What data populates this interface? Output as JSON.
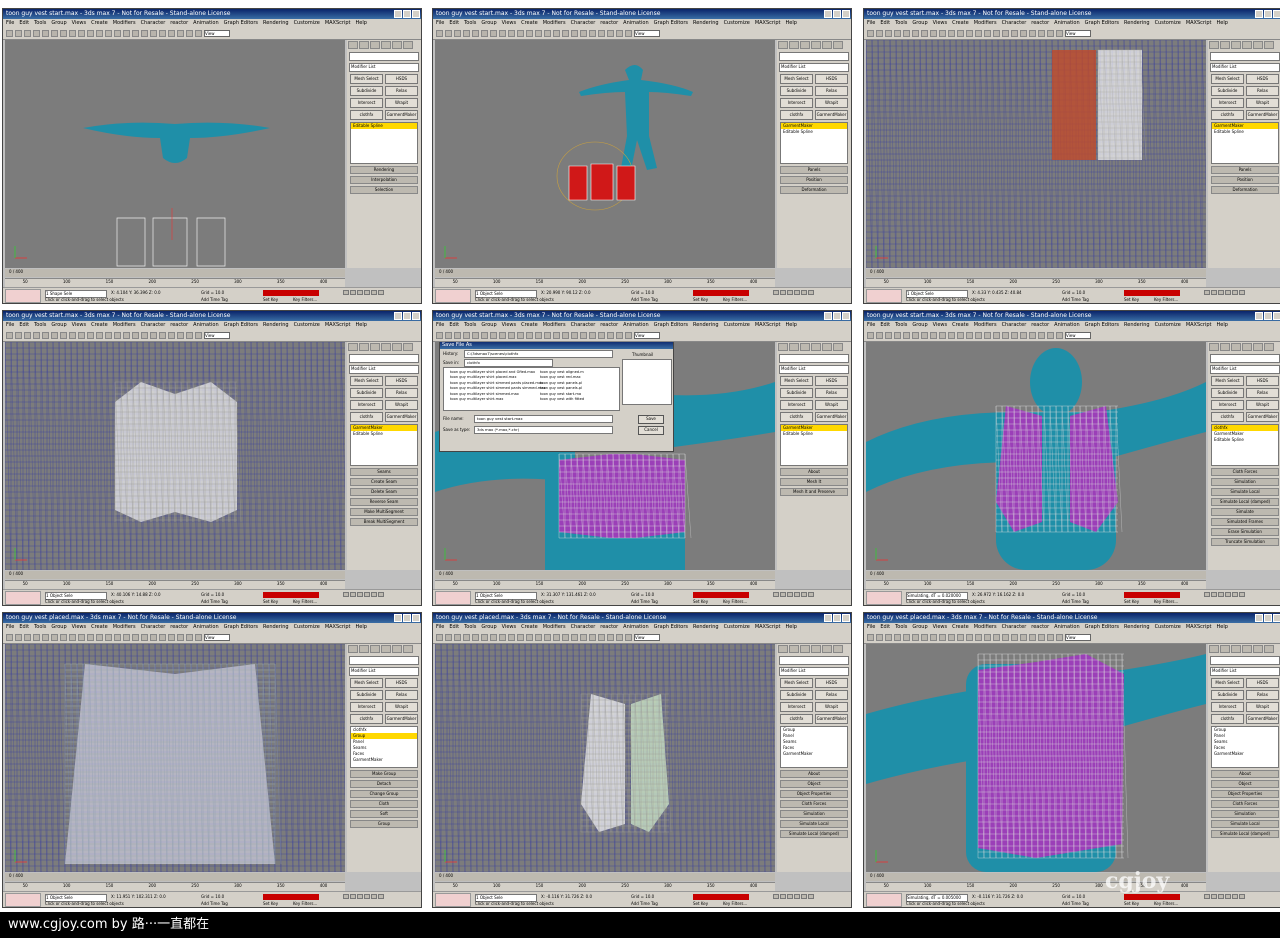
{
  "footer": {
    "text": "www.cgjoy.com by 路···一直都在"
  },
  "watermark": {
    "text": "cgjoy"
  },
  "app": {
    "menu": [
      "File",
      "Edit",
      "Tools",
      "Group",
      "Views",
      "Create",
      "Modifiers",
      "Character",
      "reactor",
      "Animation",
      "Graph Editors",
      "Rendering",
      "Customize",
      "MAXScript",
      "Help"
    ],
    "viewport_label": "View",
    "modifier_list": "Modifier List",
    "buttons": [
      [
        "Mesh Select",
        "HSDS"
      ],
      [
        "Subdivide",
        "Relax"
      ],
      [
        "Intersect",
        "Wrapit"
      ],
      [
        "clothfx",
        "GarmentMaker"
      ]
    ],
    "timeline_label": "0 / 400",
    "ticks": [
      "50",
      "100",
      "150",
      "200",
      "250",
      "300",
      "350",
      "400"
    ],
    "grid": "Grid = 10.0",
    "add_time_tag": "Add Time Tag",
    "auto_key": "Auto Key",
    "selected": "Selected",
    "set_key": "Set Key",
    "key_filters": "Key Filters...",
    "status_hint": "Click or click-and-drag to select objects"
  },
  "panels": [
    {
      "title": "toon guy vest start.max - 3ds max 7 - Not for Resale - Stand-alone License",
      "status": "1 Shape Sele",
      "coords": "X: 4.104   Y: 36.396   Z: 0.0",
      "stack": [
        "Editable Spline"
      ],
      "stack_hl": 0,
      "rollouts": [
        "Rendering",
        "Interpolation",
        "Selection"
      ]
    },
    {
      "title": "toon guy vest start.max - 3ds max 7 - Not for Resale - Stand-alone License",
      "status": "1 Object Sele",
      "coords": "X: 20.990   Y: 90.12   Z: 0.0",
      "stack": [
        "GarmentMaker",
        "Editable Spline"
      ],
      "stack_hl": 0,
      "rollouts": [
        "Panels",
        "Position",
        "Deformation"
      ]
    },
    {
      "title": "toon guy vest start.max - 3ds max 7 - Not for Resale - Stand-alone License",
      "status": "1 Object Sele",
      "coords": "X: 4.33   Y: 0.435   Z: 40.84",
      "stack": [
        "GarmentMaker",
        "Editable Spline"
      ],
      "stack_hl": 0,
      "rollouts": [
        "Panels",
        "Position",
        "Deformation"
      ]
    },
    {
      "title": "toon guy vest start.max - 3ds max 7 - Not for Resale - Stand-alone License",
      "status": "1 Object Sele",
      "coords": "X: 40.106   Y: 14.88   Z: 0.0",
      "stack": [
        "GarmentMaker",
        "Editable Spline"
      ],
      "stack_hl": 0,
      "rollouts": [
        "Seams",
        "Create Seam",
        "Delete Seam",
        "Reverse Seam",
        "Make MultiSegment",
        "Break MultiSegment"
      ]
    },
    {
      "title": "toon guy vest start.max - 3ds max 7 - Not for Resale - Stand-alone License",
      "status": "1 Object Sele",
      "coords": "X: 31.307   Y: 131.461   Z: 0.0",
      "stack": [
        "GarmentMaker",
        "Editable Spline"
      ],
      "stack_hl": 0,
      "rollouts": [
        "About",
        "Mesh It",
        "Mesh It and Preserve"
      ],
      "dialog": {
        "title": "Save File As",
        "history_label": "History:",
        "history": "C:\\3dsmax7\\scenes\\clothfx",
        "savein_label": "Save in:",
        "savein": "clothfx",
        "thumb_label": "Thumbnail",
        "files": [
          "toon guy multilayer shirt placed and Gfied.max",
          "toon guy multilayer shirt placed.max",
          "toon guy multilayer shirt simmed pants placed.max",
          "toon guy multilayer shirt simmed pants simmed.max",
          "toon guy multilayer shirt simmed.max",
          "toon guy multilayer shirt.max"
        ],
        "files2": [
          "toon guy vest aligned.m",
          "toon guy vest red.max",
          "toon guy vest panels.pl",
          "toon guy vest panels.pl",
          "toon guy vest start.ma",
          "toon guy vest with fitted"
        ],
        "filename_label": "File name:",
        "filename": "toon guy vest start.max",
        "saveas_label": "Save as type:",
        "saveas": "3ds max (*.max,*.chr)",
        "save": "Save",
        "cancel": "Cancel"
      }
    },
    {
      "title": "toon guy vest start.max - 3ds max 7 - Not for Resale - Stand-alone License",
      "status": "Simulating, dT = 0.020000",
      "coords": "X: 26.972   Y: 16.162   Z: 0.0",
      "stack": [
        "clothfx",
        "GarmentMaker",
        "Editable Spline"
      ],
      "stack_hl": 0,
      "rollouts": [
        "Cloth Forces",
        "Simulation",
        "Simulate Local",
        "Simulate Local (damped)",
        "Simulate",
        "Simulated Frames",
        "Erase Simulation",
        "Truncate Simulation"
      ]
    },
    {
      "title": "toon guy vest placed.max - 3ds max 7 - Not for Resale - Stand-alone License",
      "status": "1 Object Sele",
      "coords": "X: 11.951   Y: 102.311   Z: 0.0",
      "stack": [
        "clothfx",
        "Group",
        "Panel",
        "Seams",
        "Faces",
        "GarmentMaker"
      ],
      "stack_hl": 1,
      "rollouts": [
        "Make Group",
        "Detach",
        "Change Group",
        "Cloth",
        "Soft",
        "Group"
      ]
    },
    {
      "title": "toon guy vest placed.max - 3ds max 7 - Not for Resale - Stand-alone License",
      "status": "1 Object Sele",
      "coords": "X: -0.116   Y: 31.726   Z: 0.0",
      "stack": [
        "Group",
        "Panel",
        "Seams",
        "Faces",
        "GarmentMaker"
      ],
      "stack_hl": -1,
      "rollouts": [
        "About",
        "Object",
        "Object Properties",
        "Cloth Forces",
        "Simulation",
        "Simulate Local",
        "Simulate Local (damped)"
      ]
    },
    {
      "title": "toon guy vest placed.max - 3ds max 7 - Not for Resale - Stand-alone License",
      "status": "Simulating, dT = 0.005000",
      "coords": "X: -0.116   Y: 31.726   Z: 0.0",
      "stack": [
        "Group",
        "Panel",
        "Seams",
        "Faces",
        "GarmentMaker"
      ],
      "stack_hl": -1,
      "rollouts": [
        "About",
        "Object",
        "Object Properties",
        "Cloth Forces",
        "Simulation",
        "Simulate Local",
        "Simulate Local (damped)"
      ]
    }
  ]
}
